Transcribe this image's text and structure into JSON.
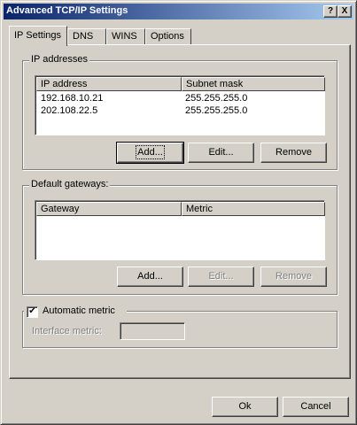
{
  "window": {
    "title": "Advanced TCP/IP Settings",
    "help_label": "?",
    "close_label": "X"
  },
  "tabs": [
    {
      "label": "IP Settings",
      "active": true
    },
    {
      "label": "DNS"
    },
    {
      "label": "WINS"
    },
    {
      "label": "Options"
    }
  ],
  "ip_addresses": {
    "label": "IP addresses",
    "columns": [
      "IP address",
      "Subnet mask"
    ],
    "rows": [
      {
        "ip": "192.168.10.21",
        "mask": "255.255.255.0"
      },
      {
        "ip": "202.108.22.5",
        "mask": "255.255.255.0"
      }
    ],
    "add_label": "Add...",
    "edit_label": "Edit...",
    "remove_label": "Remove"
  },
  "gateways": {
    "label": "Default gateways:",
    "columns": [
      "Gateway",
      "Metric"
    ],
    "add_label": "Add...",
    "edit_label": "Edit...",
    "remove_label": "Remove"
  },
  "metric": {
    "checkbox_label": "Automatic metric",
    "checked": true,
    "check_mark": "✔",
    "interface_label": "Interface metric:",
    "interface_value": ""
  },
  "footer": {
    "ok_label": "Ok",
    "cancel_label": "Cancel"
  }
}
